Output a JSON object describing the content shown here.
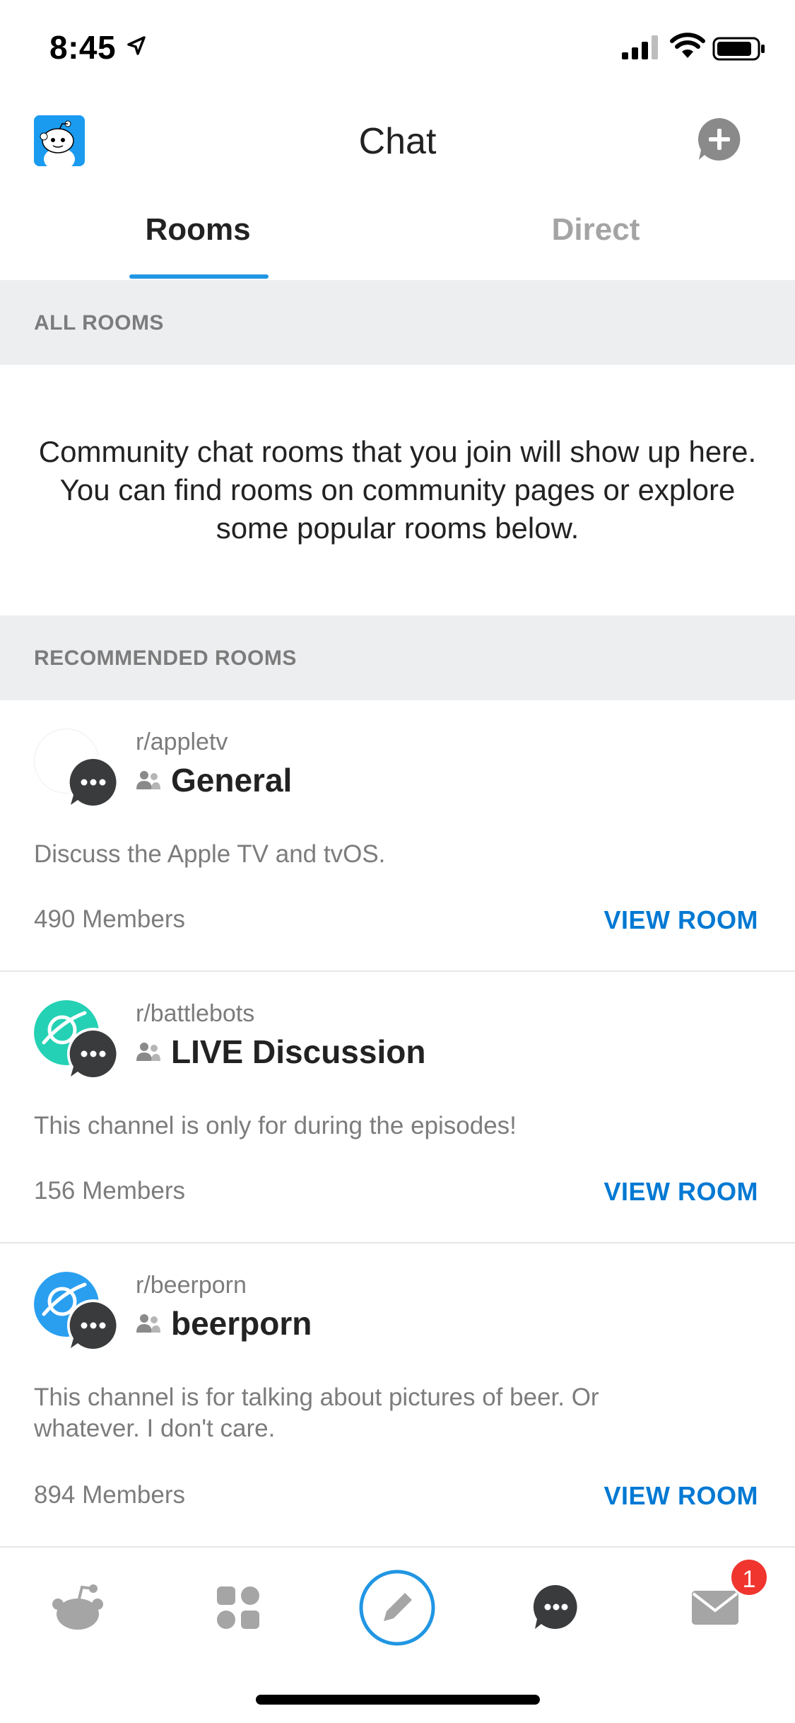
{
  "status_bar": {
    "time": "8:45"
  },
  "header": {
    "title": "Chat"
  },
  "tabs": [
    {
      "label": "Rooms",
      "active": true
    },
    {
      "label": "Direct",
      "active": false
    }
  ],
  "sections": {
    "all_rooms": "ALL ROOMS",
    "recommended": "RECOMMENDED ROOMS"
  },
  "intro_text": "Community chat rooms that you join will show up here. You can find rooms on community pages or explore some popular rooms below.",
  "rooms": [
    {
      "subreddit": "r/appletv",
      "title": "General",
      "description": "Discuss the Apple TV and tvOS.",
      "members": "490 Members",
      "action": "VIEW ROOM",
      "icon_color": "#ffffff"
    },
    {
      "subreddit": "r/battlebots",
      "title": "LIVE Discussion",
      "description": "This channel is only for during the episodes!",
      "members": "156 Members",
      "action": "VIEW ROOM",
      "icon_color": "#24d1b4"
    },
    {
      "subreddit": "r/beerporn",
      "title": "beerporn",
      "description": "This channel is for talking about pictures of beer.  Or whatever.  I don't care.",
      "members": "894 Members",
      "action": "VIEW ROOM",
      "icon_color": "#2a9ff0"
    }
  ],
  "bottom_nav": {
    "items": [
      "home-icon",
      "communities-icon",
      "create-post-icon",
      "chat-icon",
      "inbox-icon"
    ],
    "inbox_badge": "1"
  },
  "colors": {
    "accent_blue": "#0079d3",
    "tab_underline": "#2196e3",
    "section_bg": "#edeef0",
    "badge_red": "#f0352f"
  }
}
